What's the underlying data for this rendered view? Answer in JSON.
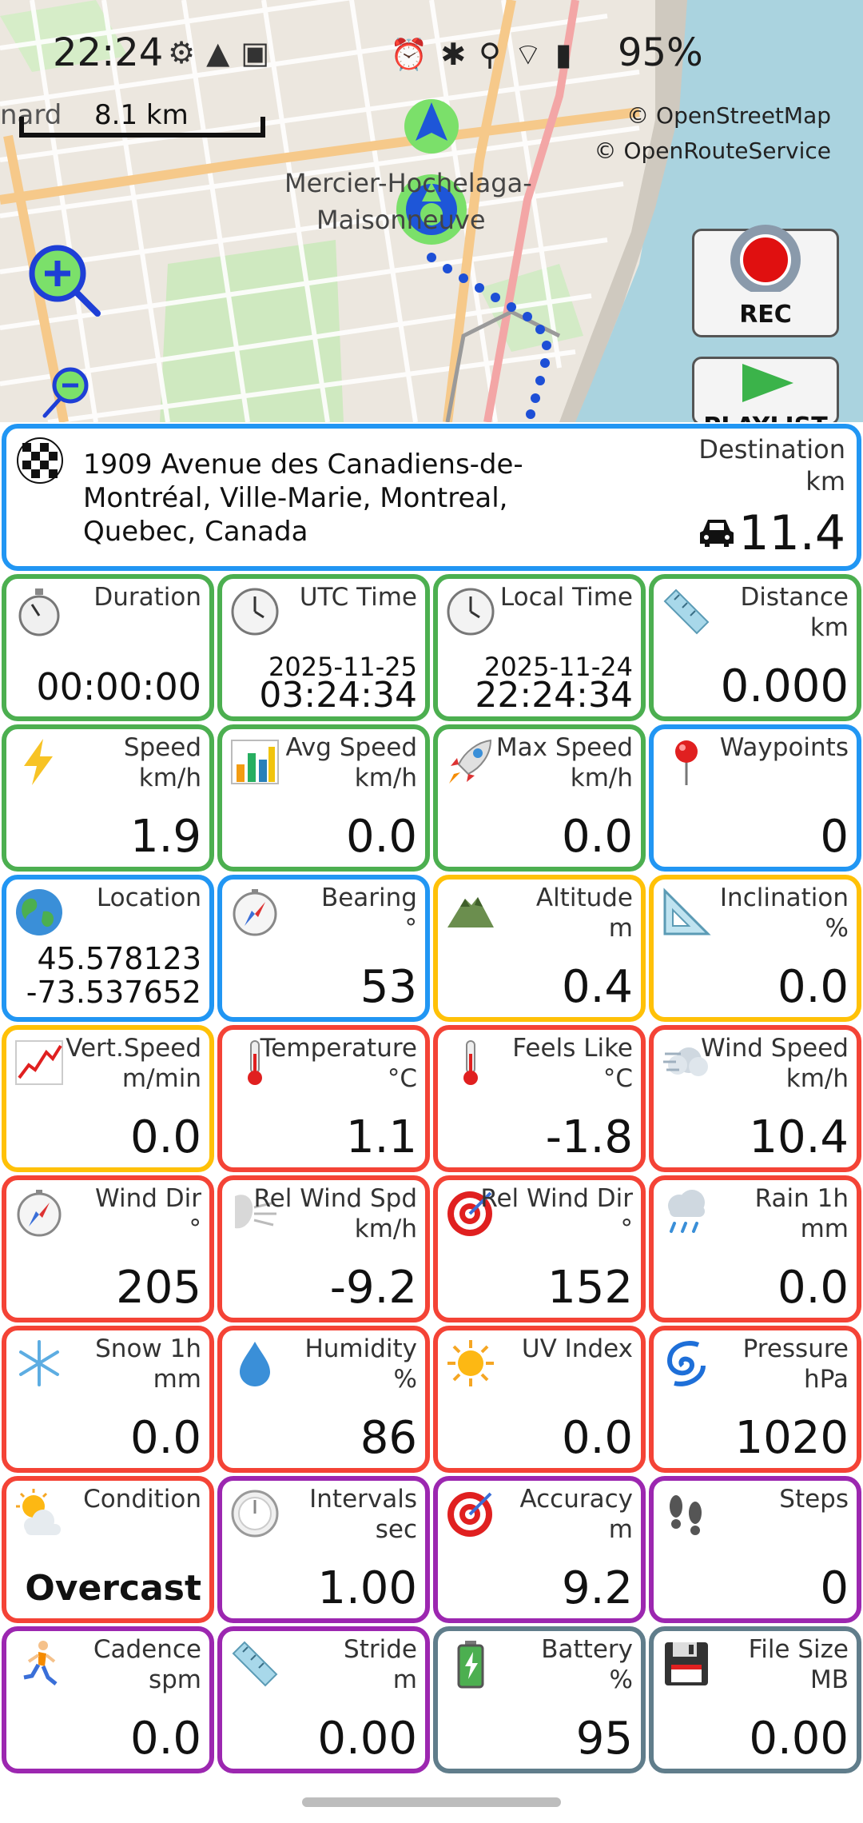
{
  "status_bar": {
    "time": "22:24",
    "battery": "95%",
    "left_icons": "⚙▲▣",
    "right_icons": "⏰✱⚲⌔▮"
  },
  "map": {
    "scale_label": "8.1 km",
    "scale_left_fragment": "nard",
    "attribution_osm": "© OpenStreetMap",
    "attribution_ors": "© OpenRouteService",
    "place_line1": "Mercier-Hochelaga-",
    "place_line2": "Maisonneuve",
    "rec_label": "REC",
    "playlist_label": "PLAYLIST"
  },
  "destination": {
    "address": "1909 Avenue des Canadiens-de-Montréal, Ville-Marie, Montreal, Quebec, Canada",
    "label": "Destination",
    "unit": "km",
    "value": "11.4"
  },
  "tiles": [
    {
      "label": "Duration",
      "unit": "",
      "value": "00:00:00"
    },
    {
      "label": "UTC Time",
      "unit": "",
      "date": "2025-11-25",
      "value": "03:24:34"
    },
    {
      "label": "Local Time",
      "unit": "",
      "date": "2025-11-24",
      "value": "22:24:34"
    },
    {
      "label": "Distance",
      "unit": "km",
      "value": "0.000"
    },
    {
      "label": "Speed",
      "unit": "km/h",
      "value": "1.9"
    },
    {
      "label": "Avg Speed",
      "unit": "km/h",
      "value": "0.0"
    },
    {
      "label": "Max Speed",
      "unit": "km/h",
      "value": "0.0"
    },
    {
      "label": "Waypoints",
      "unit": "",
      "value": "0"
    },
    {
      "label": "Location",
      "unit": "",
      "lat": "45.578123",
      "lon": "-73.537652"
    },
    {
      "label": "Bearing",
      "unit": "°",
      "value": "53"
    },
    {
      "label": "Altitude",
      "unit": "m",
      "value": "0.4"
    },
    {
      "label": "Inclination",
      "unit": "%",
      "value": "0.0"
    },
    {
      "label": "Vert.Speed",
      "unit": "m/min",
      "value": "0.0"
    },
    {
      "label": "Temperature",
      "unit": "°C",
      "value": "1.1"
    },
    {
      "label": "Feels Like",
      "unit": "°C",
      "value": "-1.8"
    },
    {
      "label": "Wind Speed",
      "unit": "km/h",
      "value": "10.4"
    },
    {
      "label": "Wind Dir",
      "unit": "°",
      "value": "205"
    },
    {
      "label": "Rel Wind Spd",
      "unit": "km/h",
      "value": "-9.2"
    },
    {
      "label": "Rel Wind Dir",
      "unit": "°",
      "value": "152"
    },
    {
      "label": "Rain 1h",
      "unit": "mm",
      "value": "0.0"
    },
    {
      "label": "Snow 1h",
      "unit": "mm",
      "value": "0.0"
    },
    {
      "label": "Humidity",
      "unit": "%",
      "value": "86"
    },
    {
      "label": "UV Index",
      "unit": "",
      "value": "0.0"
    },
    {
      "label": "Pressure",
      "unit": "hPa",
      "value": "1020"
    },
    {
      "label": "Condition",
      "unit": "",
      "value": "Overcast"
    },
    {
      "label": "Intervals",
      "unit": "sec",
      "value": "1.00"
    },
    {
      "label": "Accuracy",
      "unit": "m",
      "value": "9.2"
    },
    {
      "label": "Steps",
      "unit": "",
      "value": "0"
    },
    {
      "label": "Cadence",
      "unit": "spm",
      "value": "0.0"
    },
    {
      "label": "Stride",
      "unit": "m",
      "value": "0.00"
    },
    {
      "label": "Battery",
      "unit": "%",
      "value": "95"
    },
    {
      "label": "File Size",
      "unit": "MB",
      "value": "0.00"
    }
  ],
  "colors": {
    "blue": "#2196f3",
    "green": "#4caf50",
    "yellow": "#ffc107",
    "red": "#f44336",
    "purple": "#9c27b0",
    "slate": "#607d8b"
  }
}
